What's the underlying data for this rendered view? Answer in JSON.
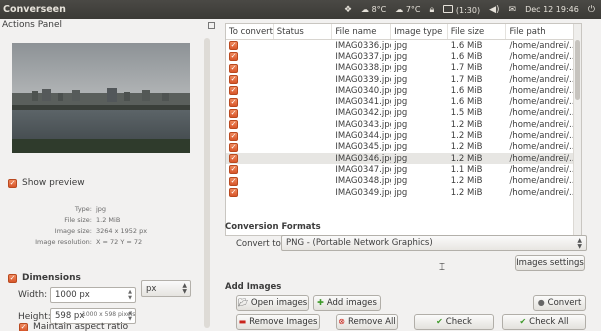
{
  "app": {
    "title": "Converseen"
  },
  "tray": {
    "temp1": "8°C",
    "temp2": "7°C",
    "battery": "(1:30)",
    "datetime": "Dec 12 19:46"
  },
  "left": {
    "title": "Actions Panel",
    "show_preview": "Show preview",
    "info": {
      "type_label": "Type:",
      "type_value": "jpg",
      "size_label": "File size:",
      "size_value": "1.2 MiB",
      "image_size_label": "Image size:",
      "image_size_value": "3264 x 1952 px",
      "resolution_label": "Image resolution:",
      "resolution_value": "X = 72 Y = 72"
    },
    "dimensions": {
      "title": "Dimensions",
      "width_label": "Width:",
      "width_value": "1000 px",
      "height_label": "Height:",
      "height_value": "598 px",
      "unit": "px",
      "note": "1000 x 598 pixels",
      "maintain": "Maintain aspect ratio"
    }
  },
  "table": {
    "headers": [
      "To convert",
      "Status",
      "File name",
      "Image type",
      "File size",
      "File path"
    ],
    "rows": [
      {
        "name": "IMAG0336.jpg",
        "type": "jpg",
        "size": "1.6 MiB",
        "path": "/home/andrei/..."
      },
      {
        "name": "IMAG0337.jpg",
        "type": "jpg",
        "size": "1.6 MiB",
        "path": "/home/andrei/..."
      },
      {
        "name": "IMAG0338.jpg",
        "type": "jpg",
        "size": "1.7 MiB",
        "path": "/home/andrei/..."
      },
      {
        "name": "IMAG0339.jpg",
        "type": "jpg",
        "size": "1.7 MiB",
        "path": "/home/andrei/..."
      },
      {
        "name": "IMAG0340.jpg",
        "type": "jpg",
        "size": "1.6 MiB",
        "path": "/home/andrei/..."
      },
      {
        "name": "IMAG0341.jpg",
        "type": "jpg",
        "size": "1.6 MiB",
        "path": "/home/andrei/..."
      },
      {
        "name": "IMAG0342.jpg",
        "type": "jpg",
        "size": "1.5 MiB",
        "path": "/home/andrei/..."
      },
      {
        "name": "IMAG0343.jpg",
        "type": "jpg",
        "size": "1.2 MiB",
        "path": "/home/andrei/..."
      },
      {
        "name": "IMAG0344.jpg",
        "type": "jpg",
        "size": "1.2 MiB",
        "path": "/home/andrei/..."
      },
      {
        "name": "IMAG0345.jpg",
        "type": "jpg",
        "size": "1.2 MiB",
        "path": "/home/andrei/..."
      },
      {
        "name": "IMAG0346.jpg",
        "type": "jpg",
        "size": "1.2 MiB",
        "path": "/home/andrei/..."
      },
      {
        "name": "IMAG0347.jpg",
        "type": "jpg",
        "size": "1.1 MiB",
        "path": "/home/andrei/..."
      },
      {
        "name": "IMAG0348.jpg",
        "type": "jpg",
        "size": "1.2 MiB",
        "path": "/home/andrei/..."
      },
      {
        "name": "IMAG0349.jpg",
        "type": "jpg",
        "size": "1.2 MiB",
        "path": "/home/andrei/..."
      }
    ],
    "selected_index": 10
  },
  "conversion": {
    "title": "Conversion Formats",
    "convert_to_label": "Convert to:",
    "format": "PNG - (Portable Network Graphics)",
    "settings_button": "Images settings"
  },
  "add_images": {
    "title": "Add Images",
    "open": "Open images",
    "add": "Add images",
    "convert": "Convert",
    "remove_images": "Remove Images",
    "remove_all": "Remove All",
    "check": "Check",
    "check_all": "Check All"
  },
  "colors": {
    "accent": "#dd5a2b",
    "topbar": "#3f3e3a",
    "selected_row": "#e7e6e3"
  }
}
